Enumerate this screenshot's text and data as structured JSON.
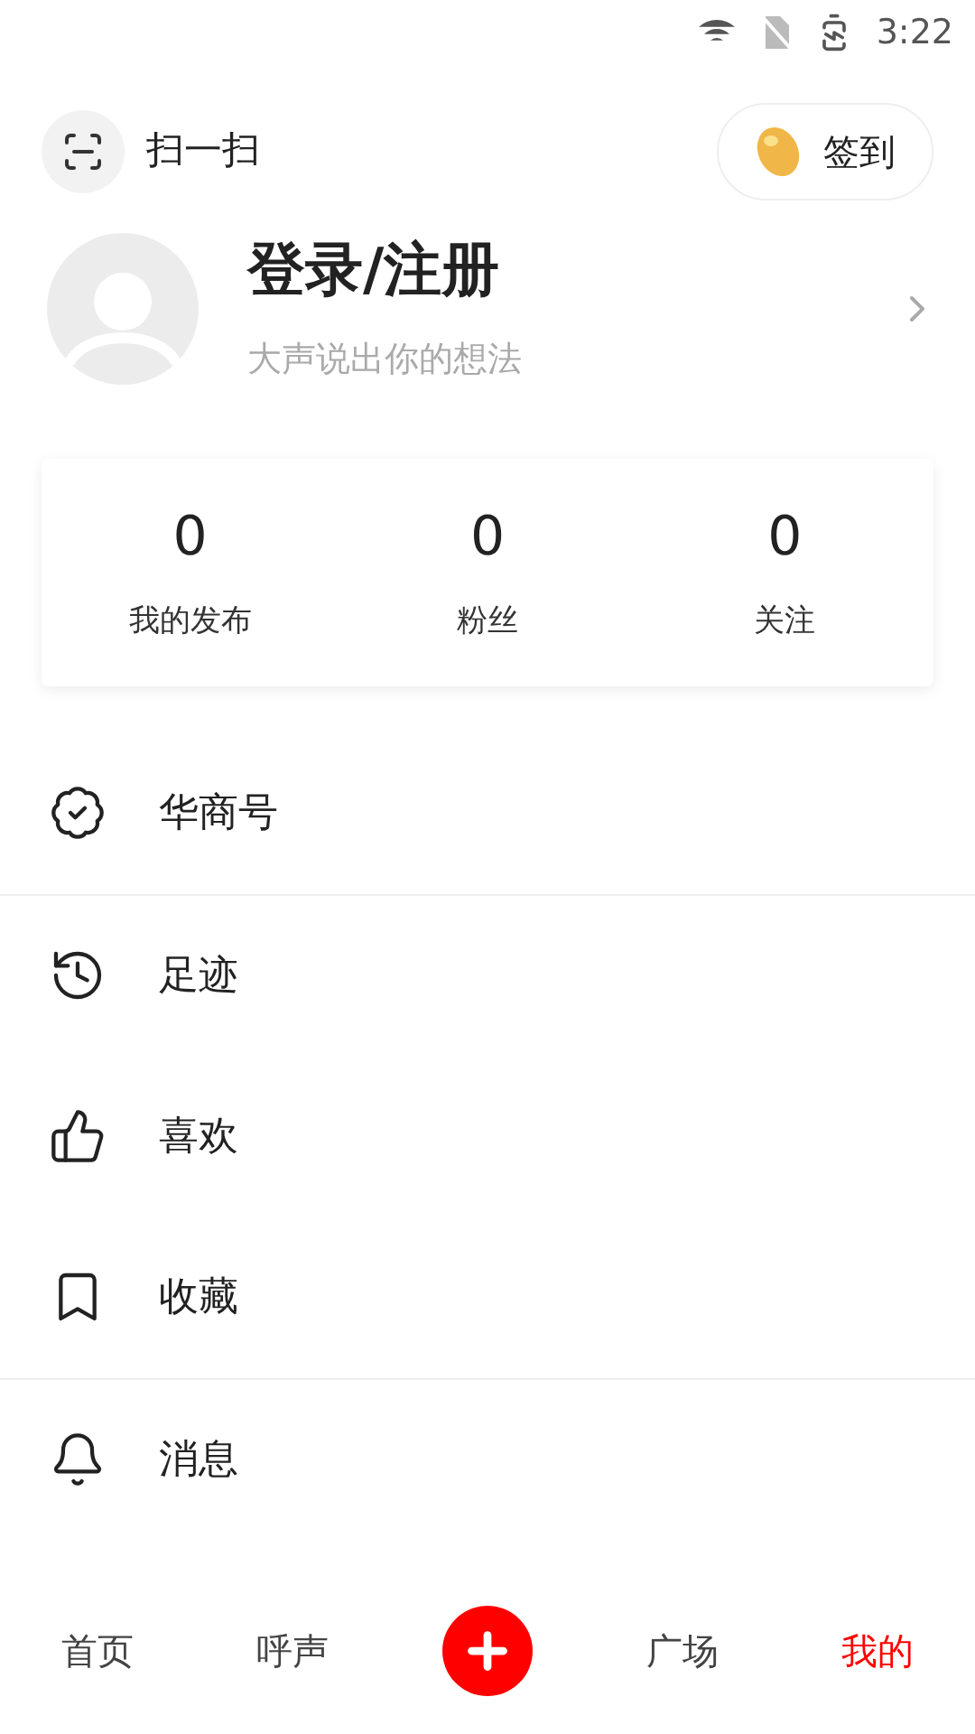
{
  "status_bar": {
    "time": "3:22"
  },
  "header": {
    "scan_label": "扫一扫",
    "checkin_label": "签到"
  },
  "profile": {
    "name": "登录/注册",
    "tagline": "大声说出你的想法"
  },
  "stats": [
    {
      "value": "0",
      "label": "我的发布"
    },
    {
      "value": "0",
      "label": "粉丝"
    },
    {
      "value": "0",
      "label": "关注"
    }
  ],
  "menu_sections": [
    [
      {
        "kind": "verified",
        "label": "华商号"
      }
    ],
    [
      {
        "kind": "history",
        "label": "足迹"
      },
      {
        "kind": "like",
        "label": "喜欢"
      },
      {
        "kind": "bookmark",
        "label": "收藏"
      }
    ],
    [
      {
        "kind": "bell",
        "label": "消息"
      }
    ]
  ],
  "bottom_nav": [
    {
      "kind": "tab",
      "label": "首页",
      "selected": false
    },
    {
      "kind": "tab",
      "label": "呼声",
      "selected": false
    },
    {
      "kind": "add"
    },
    {
      "kind": "tab",
      "label": "广场",
      "selected": false
    },
    {
      "kind": "tab",
      "label": "我的",
      "selected": true
    }
  ]
}
